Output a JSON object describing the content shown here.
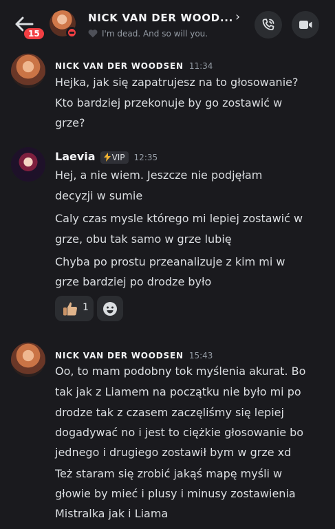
{
  "header": {
    "unread_count": "15",
    "name": "NICK VAN DER WOOD...",
    "status": "I'm dead. And so will you.",
    "chevron": "›"
  },
  "messages": [
    {
      "author": "NICK VAN DER WOODSEN",
      "time": "11:34",
      "lines": [
        "Hejka, jak się zapatrujesz na to głosowanie?",
        "Kto bardziej przekonuje by go zostawić w",
        "grze?"
      ]
    },
    {
      "author": "Laevia",
      "badge": "VIP",
      "time": "12:35",
      "lines": [
        "Hej, a nie wiem. Jeszcze nie podjęłam",
        "decyzji w sumie",
        "Caly czas mysle którego mi lepiej zostawić w",
        "grze, obu tak samo w grze lubię",
        "Chyba po prostu przeanalizuje z kim mi w",
        "grze bardziej po drodze było"
      ],
      "reaction": {
        "icon": "thumbs-up-icon",
        "count": "1"
      }
    },
    {
      "author": "NICK VAN DER WOODSEN",
      "time": "15:43",
      "lines": [
        "Oo, to mam podobny tok myślenia akurat. Bo",
        "tak jak z Liamem na początku nie było mi po",
        "drodze tak z czasem zaczęliśmy się lepiej",
        "dogadywać no i jest to ciężkie głosowanie bo",
        "jednego i drugiego zostawił bym w grze xd",
        "Też staram się zrobić jakąś mapę myśli w",
        "głowie by mieć i plusy i minusy zostawienia",
        "Mistralka jak i Liama"
      ]
    }
  ],
  "colors": {
    "background": "#1a1a1e",
    "text": "#dbdee1",
    "muted": "#949ba4",
    "badge_red": "#f23f43",
    "button_bg": "#2b2d31"
  },
  "icons": [
    "back-arrow-icon",
    "dnd-status-icon",
    "heart-icon",
    "phone-icon",
    "video-camera-icon",
    "lightning-icon",
    "thumbs-up-icon",
    "add-reaction-icon"
  ]
}
